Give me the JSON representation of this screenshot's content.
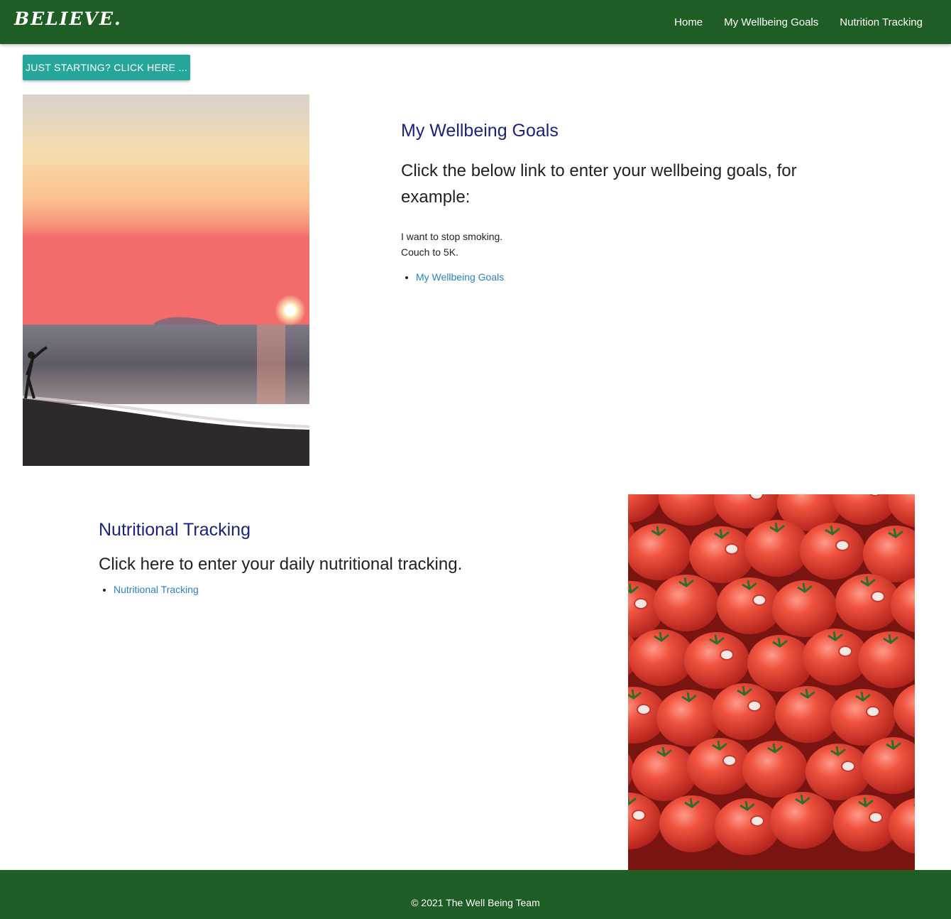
{
  "navbar": {
    "brand": "BELIEVE.",
    "links": [
      {
        "label": "Home"
      },
      {
        "label": "My Wellbeing Goals"
      },
      {
        "label": "Nutrition Tracking"
      }
    ]
  },
  "start_button": {
    "label": "JUST STARTING? CLICK HERE ..."
  },
  "goals": {
    "title": "My Wellbeing Goals",
    "lead": "Click the below link to enter your wellbeing goals, for example:",
    "examples": [
      "I want to stop smoking.",
      "Couch to 5K."
    ],
    "link_label": "My Wellbeing Goals"
  },
  "nutrition": {
    "title": "Nutritional Tracking",
    "lead": "Click here to enter your daily nutritional tracking.",
    "link_label": "Nutritional Tracking"
  },
  "footer": {
    "text": "© 2021 The Well Being Team"
  },
  "colors": {
    "nav_bg": "#1e5e24",
    "button_bg": "#26a69a",
    "title_color": "#1a237e",
    "link_color": "#2b82c4"
  }
}
